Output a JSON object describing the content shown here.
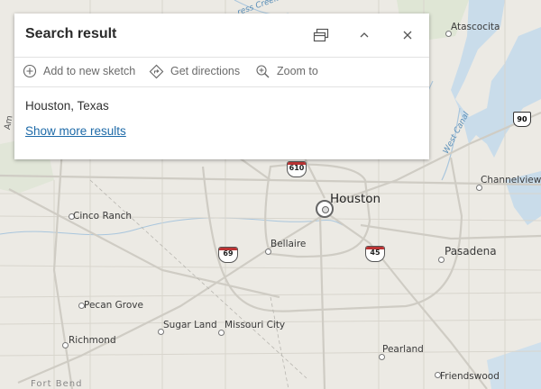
{
  "map": {
    "labels": {
      "houston": "Houston",
      "atascocita": "Atascocita",
      "channelview": "Channelview",
      "pasadena": "Pasadena",
      "cinco_ranch": "Cinco Ranch",
      "bellaire": "Bellaire",
      "pecan_grove": "Pecan Grove",
      "sugar_land": "Sugar Land",
      "missouri_city": "Missouri City",
      "richmond": "Richmond",
      "pearland": "Pearland",
      "friendswood": "Friendswood",
      "fort_bend": "Fort Bend",
      "west_canal": "West Canal",
      "fragment_am": "Am",
      "fragment_creek": "ress Creek"
    },
    "shields": {
      "i610": "610",
      "i69": "69",
      "i45": "45",
      "us90": "90"
    }
  },
  "panel": {
    "title": "Search result",
    "actions": {
      "add_sketch": "Add to new sketch",
      "directions": "Get directions",
      "zoom": "Zoom to"
    },
    "result": "Houston, Texas",
    "more": "Show more results"
  }
}
